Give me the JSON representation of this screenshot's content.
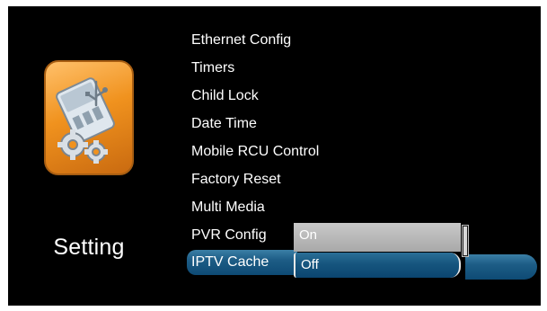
{
  "side_panel": {
    "title": "Setting",
    "icon": "settings-tools-icon"
  },
  "menu": {
    "items": [
      {
        "label": "Ethernet Config"
      },
      {
        "label": "Timers"
      },
      {
        "label": "Child Lock"
      },
      {
        "label": "Date Time"
      },
      {
        "label": "Mobile RCU Control"
      },
      {
        "label": "Factory Reset"
      },
      {
        "label": "Multi Media"
      },
      {
        "label": "PVR Config"
      },
      {
        "label": "IPTV Cache"
      }
    ],
    "selected_index": 8
  },
  "dropdown": {
    "options": [
      {
        "label": "On"
      },
      {
        "label": "Off"
      }
    ],
    "selected": "Off"
  },
  "colors": {
    "background": "#000000",
    "highlight": "#1d5d86",
    "icon_tile": "#f0921e"
  }
}
